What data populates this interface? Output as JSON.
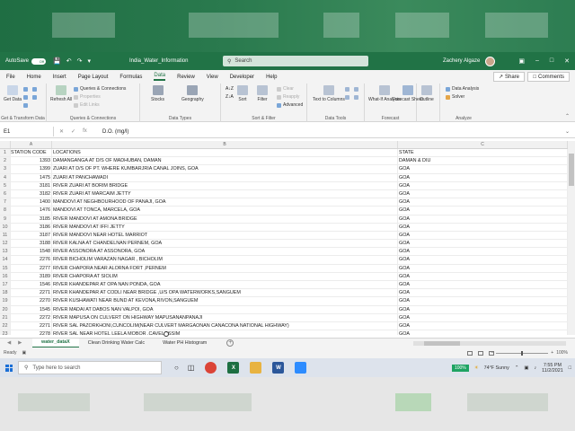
{
  "titlebar": {
    "autosave_label": "AutoSave",
    "autosave_state": "Off",
    "doc_title": "India_Water_Information",
    "search_placeholder": "Search",
    "user_name": "Zachery Algaze",
    "undo_icon": "undo-icon",
    "redo_icon": "redo-icon"
  },
  "menu": {
    "tabs": [
      "File",
      "Home",
      "Insert",
      "Page Layout",
      "Formulas",
      "Data",
      "Review",
      "View",
      "Developer",
      "Help"
    ],
    "active": "Data",
    "share_label": "Share",
    "comments_label": "Comments"
  },
  "ribbon": {
    "get_data_label": "Get Data",
    "get_transform_group": "Get & Transform Data",
    "refresh_all_label": "Refresh All",
    "queries_connections": "Queries & Connections",
    "properties": "Properties",
    "edit_links": "Edit Links",
    "queries_group": "Queries & Connections",
    "stocks": "Stocks",
    "geography": "Geography",
    "data_types_group": "Data Types",
    "sort": "Sort",
    "filter": "Filter",
    "clear": "Clear",
    "reapply": "Reapply",
    "advanced": "Advanced",
    "sort_filter_group": "Sort & Filter",
    "text_to_columns": "Text to Columns",
    "data_tools_group": "Data Tools",
    "what_if": "What-If Analysis",
    "forecast_sheet": "Forecast Sheet",
    "forecast_group": "Forecast",
    "outline": "Outline",
    "data_analysis": "Data Analysis",
    "solver": "Solver",
    "analyze_group": "Analyze"
  },
  "formula_bar": {
    "name_box": "E1",
    "content": "D.O. (mg/l)"
  },
  "grid": {
    "columns": [
      "A",
      "B",
      "C"
    ],
    "header_row": {
      "num": "1",
      "a": "STATION CODE",
      "b": "LOCATIONS",
      "c": "STATE"
    },
    "rows": [
      {
        "num": "2",
        "a": "1393",
        "b": "DAMANGANGA AT D/S OF MADHUBAN, DAMAN",
        "c": "DAMAN & DIU"
      },
      {
        "num": "3",
        "a": "1399",
        "b": "ZUARI AT D/S OF PT. WHERE KUMBARJRIA CANAL JOINS, GOA",
        "c": "GOA"
      },
      {
        "num": "4",
        "a": "1475",
        "b": "ZUARI AT PANCHAWADI",
        "c": "GOA"
      },
      {
        "num": "5",
        "a": "3181",
        "b": "RIVER ZUARI AT BORIM BRIDGE",
        "c": "GOA"
      },
      {
        "num": "6",
        "a": "3182",
        "b": "RIVER ZUARI AT MARCAIM JETTY",
        "c": "GOA"
      },
      {
        "num": "7",
        "a": "1400",
        "b": "MANDOVI AT NEGHBOURHOOD OF PANAJI, GOA",
        "c": "GOA"
      },
      {
        "num": "8",
        "a": "1476",
        "b": "MANDOVI AT TONCA, MARCELA, GOA",
        "c": "GOA"
      },
      {
        "num": "9",
        "a": "3185",
        "b": "RIVER MANDOVI AT AMONA BRIDGE",
        "c": "GOA"
      },
      {
        "num": "10",
        "a": "3186",
        "b": "RIVER MANDOVI AT IFFI JETTY",
        "c": "GOA"
      },
      {
        "num": "11",
        "a": "3187",
        "b": "RIVER MANDOVI NEAR HOTEL MARRIOT",
        "c": "GOA"
      },
      {
        "num": "12",
        "a": "3188",
        "b": "RIVER KALNA AT CHANDELNAN PERNEM, GOA",
        "c": "GOA"
      },
      {
        "num": "13",
        "a": "1548",
        "b": "RIVER ASSONORA AT ASSONORA, GOA",
        "c": "GOA"
      },
      {
        "num": "14",
        "a": "2276",
        "b": "RIVER BICHOLIM VARAZAN NAGAR , BICHOLIM",
        "c": "GOA"
      },
      {
        "num": "15",
        "a": "2277",
        "b": "RIVER CHAPORA NEAR ALORNA FORT ,PERNEM",
        "c": "GOA"
      },
      {
        "num": "16",
        "a": "3189",
        "b": "RIVER CHAPORA AT SIOLIM",
        "c": "GOA"
      },
      {
        "num": "17",
        "a": "1546",
        "b": "RIVER KHANDEPAR AT OPA NAN PONDA, GOA",
        "c": "GOA"
      },
      {
        "num": "18",
        "a": "2271",
        "b": "RIVER KHANDEPAR AT CODLI NEAR BRIDGE ,U/S OPA WATERWORKS,SANGUEM",
        "c": "GOA"
      },
      {
        "num": "19",
        "a": "2270",
        "b": "RIVER KUSHAWATI NEAR BUND AT KEVONA,RIVON,SANGUEM",
        "c": "GOA"
      },
      {
        "num": "20",
        "a": "1545",
        "b": "RIVER MADAI AT DABOS NAN  VALPOI, GOA",
        "c": "GOA"
      },
      {
        "num": "21",
        "a": "2272",
        "b": "RIVER MAPUSA ON CULVERT ON HIGHWAY MAPUSANANPANAJI",
        "c": "GOA"
      },
      {
        "num": "22",
        "a": "2271",
        "b": "RIVER SAL PAZORKHONI,CUNCOLIM(NEAR CULVERT MARGAONAN CANACONA NATIONAL HIGHWAY)",
        "c": "GOA"
      },
      {
        "num": "23",
        "a": "2278",
        "b": "RIVER SAL NEAR HOTEL LEELA MOBOR ,CAVELOSSIM",
        "c": "GOA"
      }
    ]
  },
  "sheets": {
    "tabs": [
      "water_dataX",
      "Clean Drinking Water Calc",
      "Water PH Histogram"
    ],
    "active": "water_dataX"
  },
  "status": {
    "ready": "Ready",
    "zoom": "100%"
  },
  "taskbar": {
    "search_placeholder": "Type here to search",
    "battery": "100%",
    "weather": "74°F  Sunny",
    "time": "7:55 PM",
    "date": "11/2/2021"
  },
  "colors": {
    "excel_green": "#217346",
    "chrome_red": "#db4437",
    "excel_icon": "#1d6f42",
    "word_blue": "#2b579a",
    "zoom_blue": "#2d8cff"
  }
}
